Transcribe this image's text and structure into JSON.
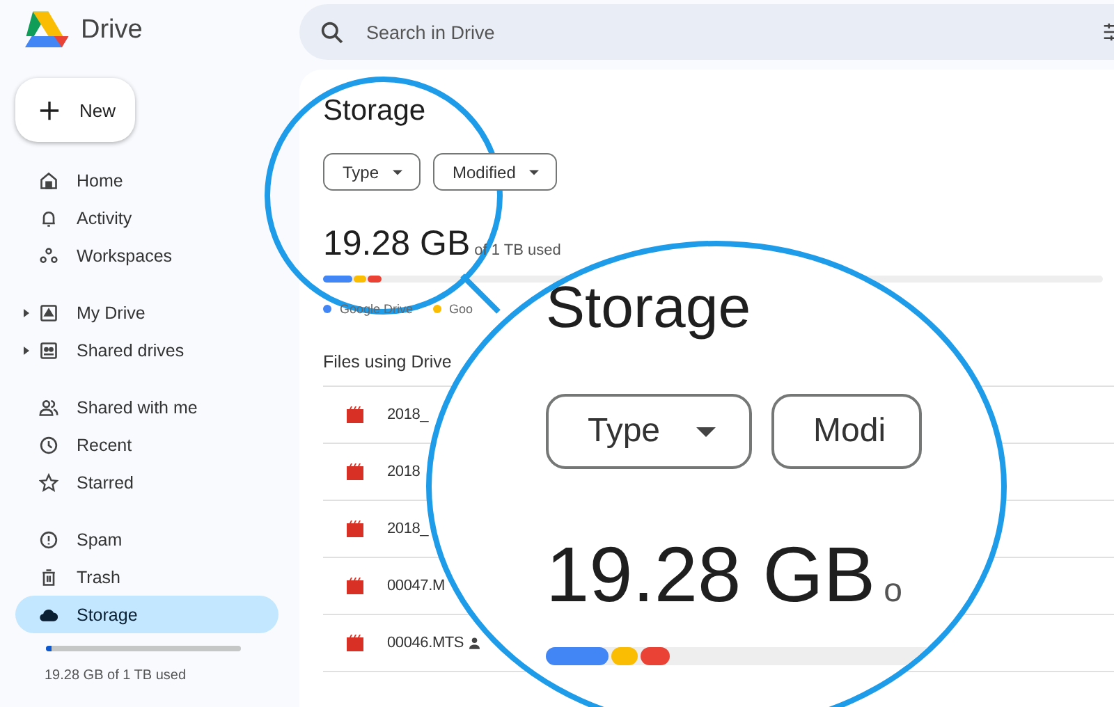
{
  "app": {
    "name": "Drive"
  },
  "new_button": {
    "label": "New"
  },
  "sidebar": {
    "sections": [
      [
        {
          "label": "Home",
          "selected": false,
          "expandable": false
        },
        {
          "label": "Activity",
          "selected": false,
          "expandable": false
        },
        {
          "label": "Workspaces",
          "selected": false,
          "expandable": false
        }
      ],
      [
        {
          "label": "My Drive",
          "selected": false,
          "expandable": true
        },
        {
          "label": "Shared drives",
          "selected": false,
          "expandable": true
        }
      ],
      [
        {
          "label": "Shared with me",
          "selected": false,
          "expandable": false
        },
        {
          "label": "Recent",
          "selected": false,
          "expandable": false
        },
        {
          "label": "Starred",
          "selected": false,
          "expandable": false
        }
      ],
      [
        {
          "label": "Spam",
          "selected": false,
          "expandable": false
        },
        {
          "label": "Trash",
          "selected": false,
          "expandable": false
        },
        {
          "label": "Storage",
          "selected": true,
          "expandable": false
        }
      ]
    ],
    "storage": {
      "level": 0.03,
      "text": "19.28 GB of 1 TB used"
    }
  },
  "search": {
    "placeholder": "Search in Drive"
  },
  "main": {
    "title": "Storage",
    "filters": [
      "Type",
      "Modified"
    ],
    "usage": {
      "amount": "19.28 GB",
      "of_text": "of 1 TB used",
      "segments": [
        {
          "color": "#4285f4",
          "level": 0.038
        },
        {
          "color": "#fbbc04",
          "level": 0.016
        },
        {
          "color": "#ea4335",
          "level": 0.018
        }
      ]
    },
    "legend": [
      {
        "label": "Google Drive",
        "color": "#4285f4"
      },
      {
        "label": "Goo",
        "color": "#fbbc04"
      }
    ],
    "section_title": "Files using Drive",
    "files": [
      {
        "name": "2018_",
        "shared": false
      },
      {
        "name": "2018",
        "shared": false
      },
      {
        "name": "2018_",
        "shared": false
      },
      {
        "name": "00047.M",
        "shared": false
      },
      {
        "name": "00046.MTS",
        "shared": true
      }
    ]
  },
  "magnifier": {
    "title": "Storage",
    "filters": [
      "Type",
      "Modi"
    ],
    "amount": "19.28 GB",
    "of_text": "o"
  }
}
